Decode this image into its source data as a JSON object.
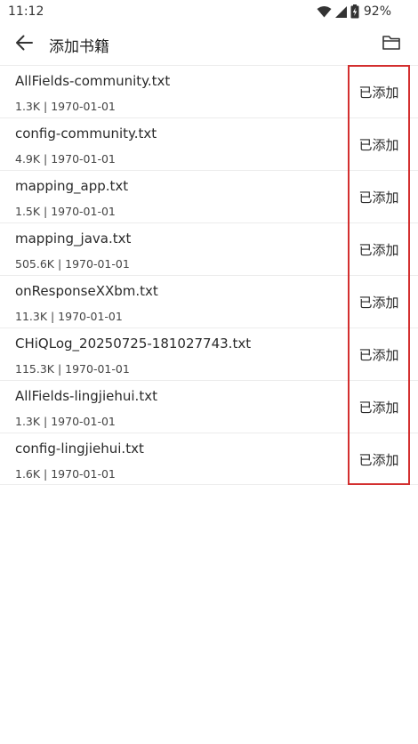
{
  "status_bar": {
    "time": "11:12",
    "battery_percent": "92%",
    "icons": [
      "wifi-icon",
      "cellular-signal-icon",
      "battery-charging-icon"
    ]
  },
  "app_bar": {
    "title": "添加书籍",
    "back_icon": "arrow-back-icon",
    "folder_icon": "folder-icon"
  },
  "files": [
    {
      "name": "AllFields-community.txt",
      "meta": "1.3K | 1970-01-01",
      "status": "已添加"
    },
    {
      "name": "config-community.txt",
      "meta": "4.9K | 1970-01-01",
      "status": "已添加"
    },
    {
      "name": "mapping_app.txt",
      "meta": "1.5K | 1970-01-01",
      "status": "已添加"
    },
    {
      "name": "mapping_java.txt",
      "meta": "505.6K | 1970-01-01",
      "status": "已添加"
    },
    {
      "name": "onResponseXXbm.txt",
      "meta": "11.3K | 1970-01-01",
      "status": "已添加"
    },
    {
      "name": "CHiQLog_20250725-181027743.txt",
      "meta": "115.3K | 1970-01-01",
      "status": "已添加"
    },
    {
      "name": "AllFields-lingjiehui.txt",
      "meta": "1.3K | 1970-01-01",
      "status": "已添加"
    },
    {
      "name": "config-lingjiehui.txt",
      "meta": "1.6K | 1970-01-01",
      "status": "已添加"
    }
  ],
  "colors": {
    "highlight_border": "#d32f2f",
    "divider": "#ececec",
    "text_primary": "#2a2a2a"
  }
}
